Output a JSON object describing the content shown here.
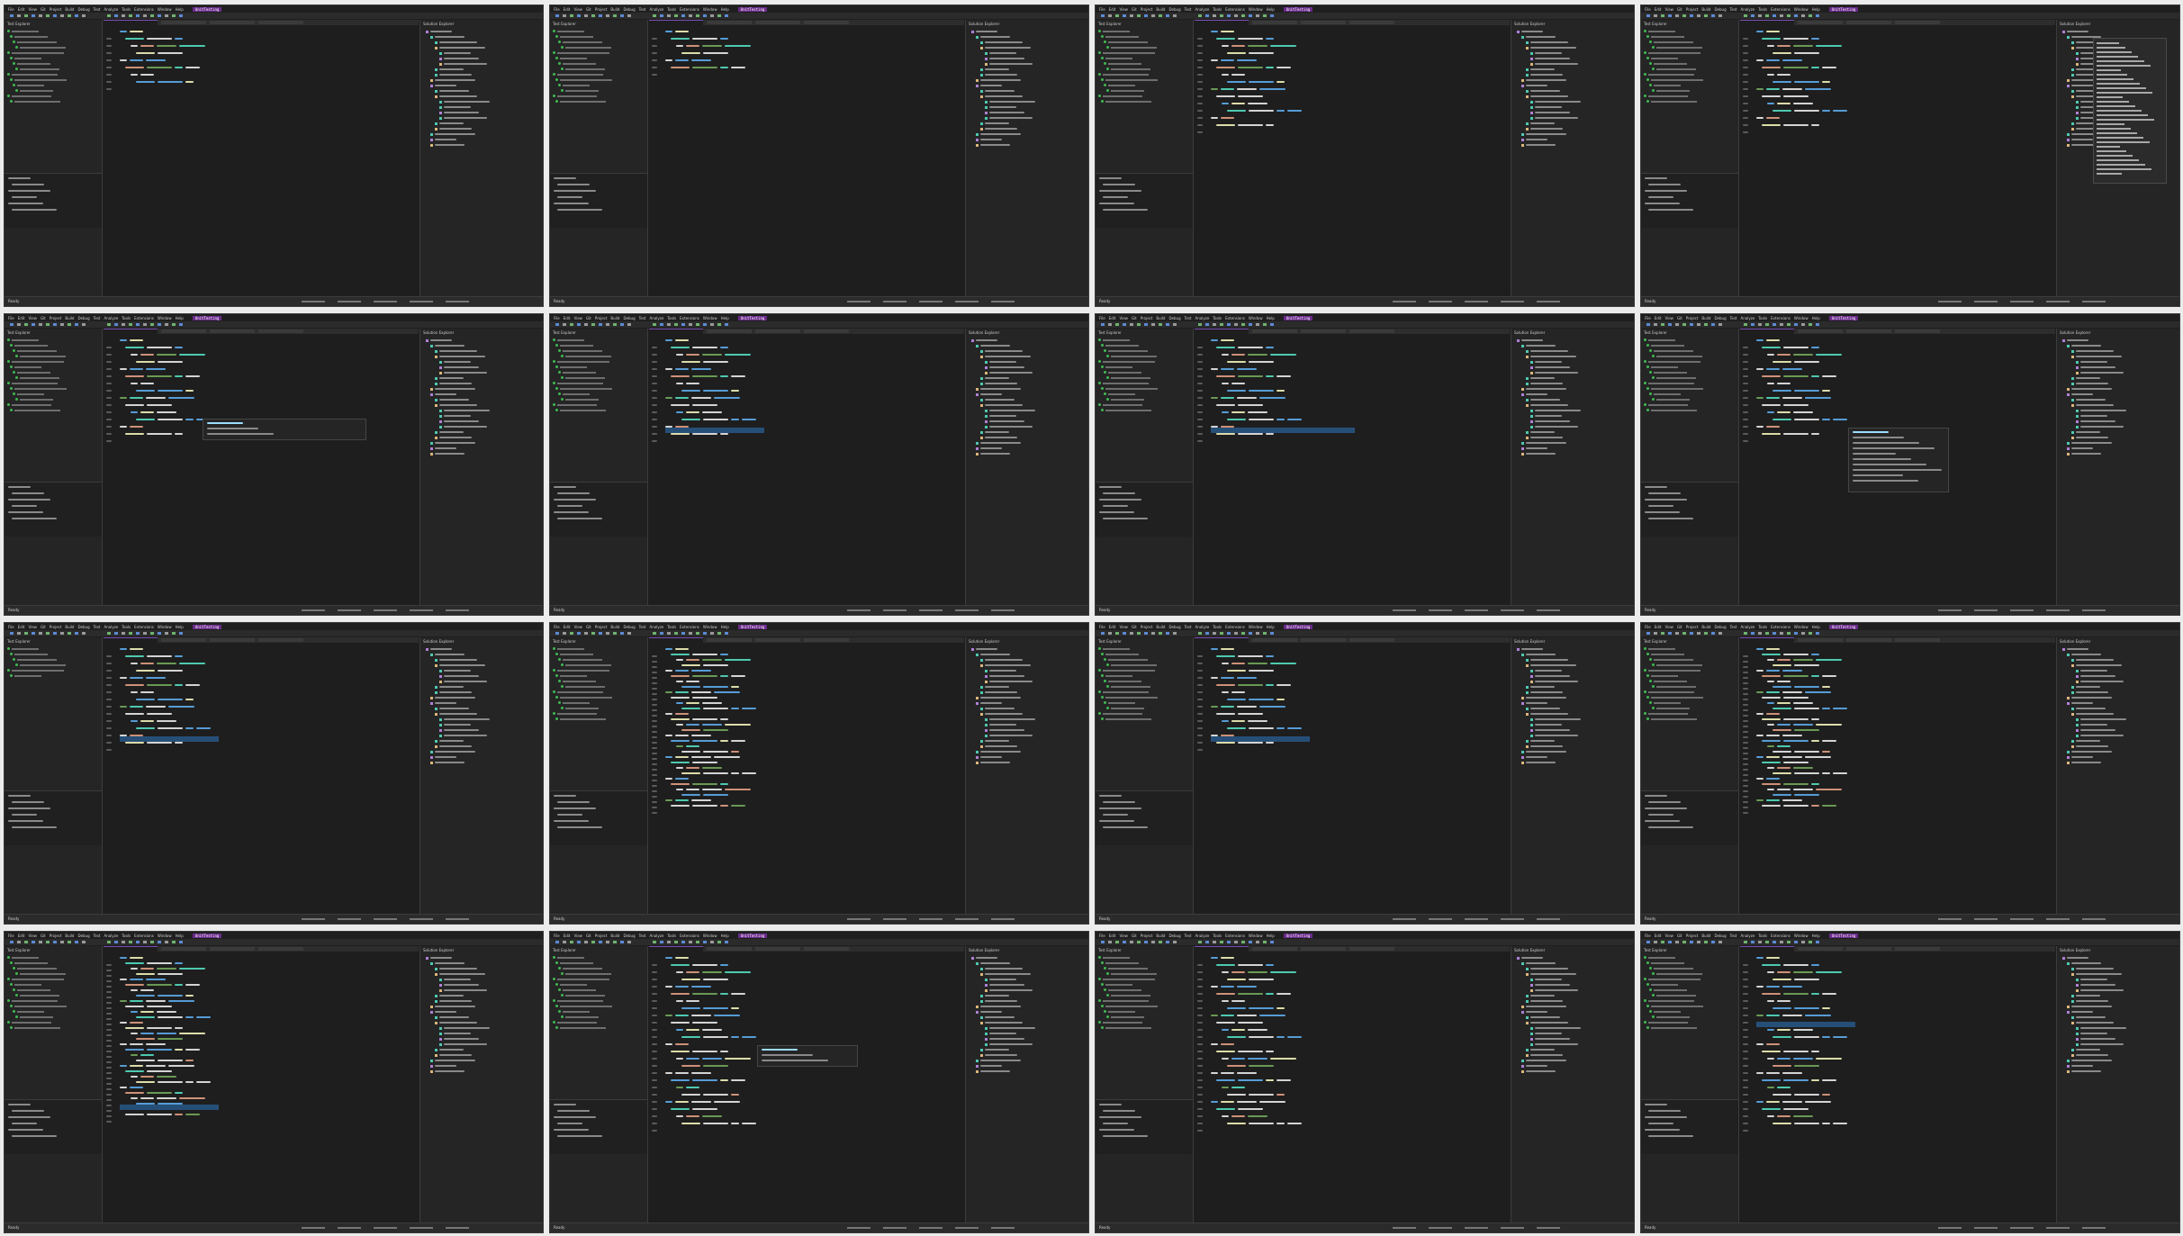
{
  "app": {
    "solution_badge": "UnitTesting",
    "menu": [
      "File",
      "Edit",
      "View",
      "Git",
      "Project",
      "Build",
      "Debug",
      "Test",
      "Analyze",
      "Tools",
      "Extensions",
      "Window",
      "Help"
    ],
    "left_panel_title": "Test Explorer",
    "right_panel_title": "Solution Explorer",
    "status_ready": "Ready"
  },
  "colors": {
    "keyword": "#569cd6",
    "type": "#4ec9b0",
    "string": "#ce9178",
    "comment": "#6a9955",
    "plain": "#d4d4d4",
    "method": "#dcdcaa",
    "pass": "#3fb950",
    "accent": "#6a2a8a"
  },
  "frames": [
    {
      "id": 1,
      "variant": "basic"
    },
    {
      "id": 2,
      "variant": "short"
    },
    {
      "id": 3,
      "variant": "class"
    },
    {
      "id": 4,
      "variant": "context-menu"
    },
    {
      "id": 5,
      "variant": "tooltip"
    },
    {
      "id": 6,
      "variant": "select"
    },
    {
      "id": 7,
      "variant": "select-wide"
    },
    {
      "id": 8,
      "variant": "intellisense"
    },
    {
      "id": 9,
      "variant": "debug"
    },
    {
      "id": 10,
      "variant": "test-code"
    },
    {
      "id": 11,
      "variant": "class-highlight"
    },
    {
      "id": 12,
      "variant": "long-test"
    },
    {
      "id": 13,
      "variant": "long-test-select"
    },
    {
      "id": 14,
      "variant": "test-popup"
    },
    {
      "id": 15,
      "variant": "test-edit"
    },
    {
      "id": 16,
      "variant": "test-highlight"
    }
  ]
}
